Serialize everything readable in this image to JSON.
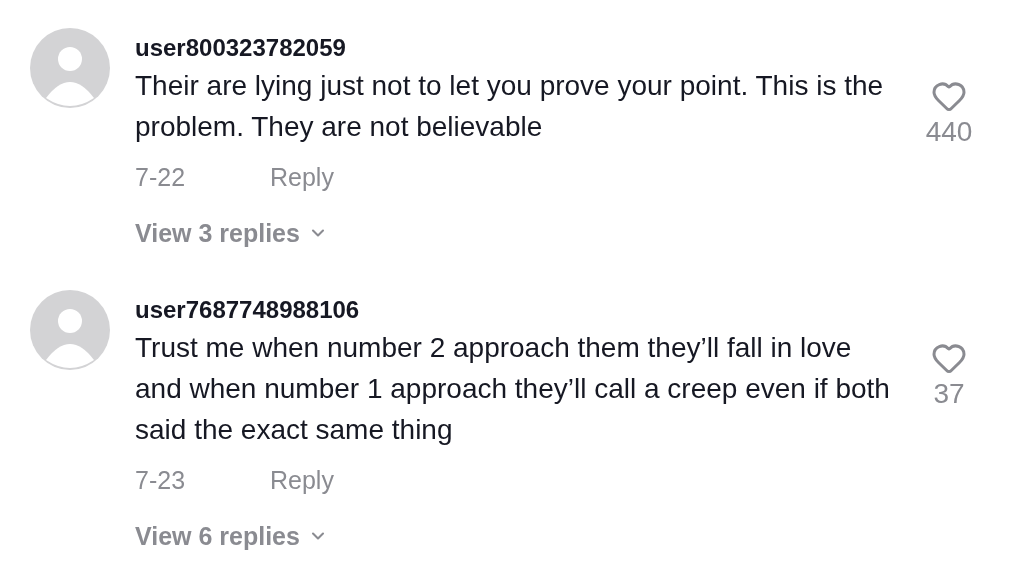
{
  "comments": [
    {
      "username": "user800323782059",
      "text": "Their are lying just not to let you prove your point. This is the problem. They are not believable",
      "likes": "440",
      "date": "7-22",
      "reply": "Reply",
      "view_replies": "View 3 replies"
    },
    {
      "username": "user7687748988106",
      "text": "Trust me when number 2 approach them they’ll fall in love and when number 1 approach they’ll call a creep even if both said the exact same thing",
      "likes": "37",
      "date": "7-23",
      "reply": "Reply",
      "view_replies": "View 6 replies"
    }
  ]
}
